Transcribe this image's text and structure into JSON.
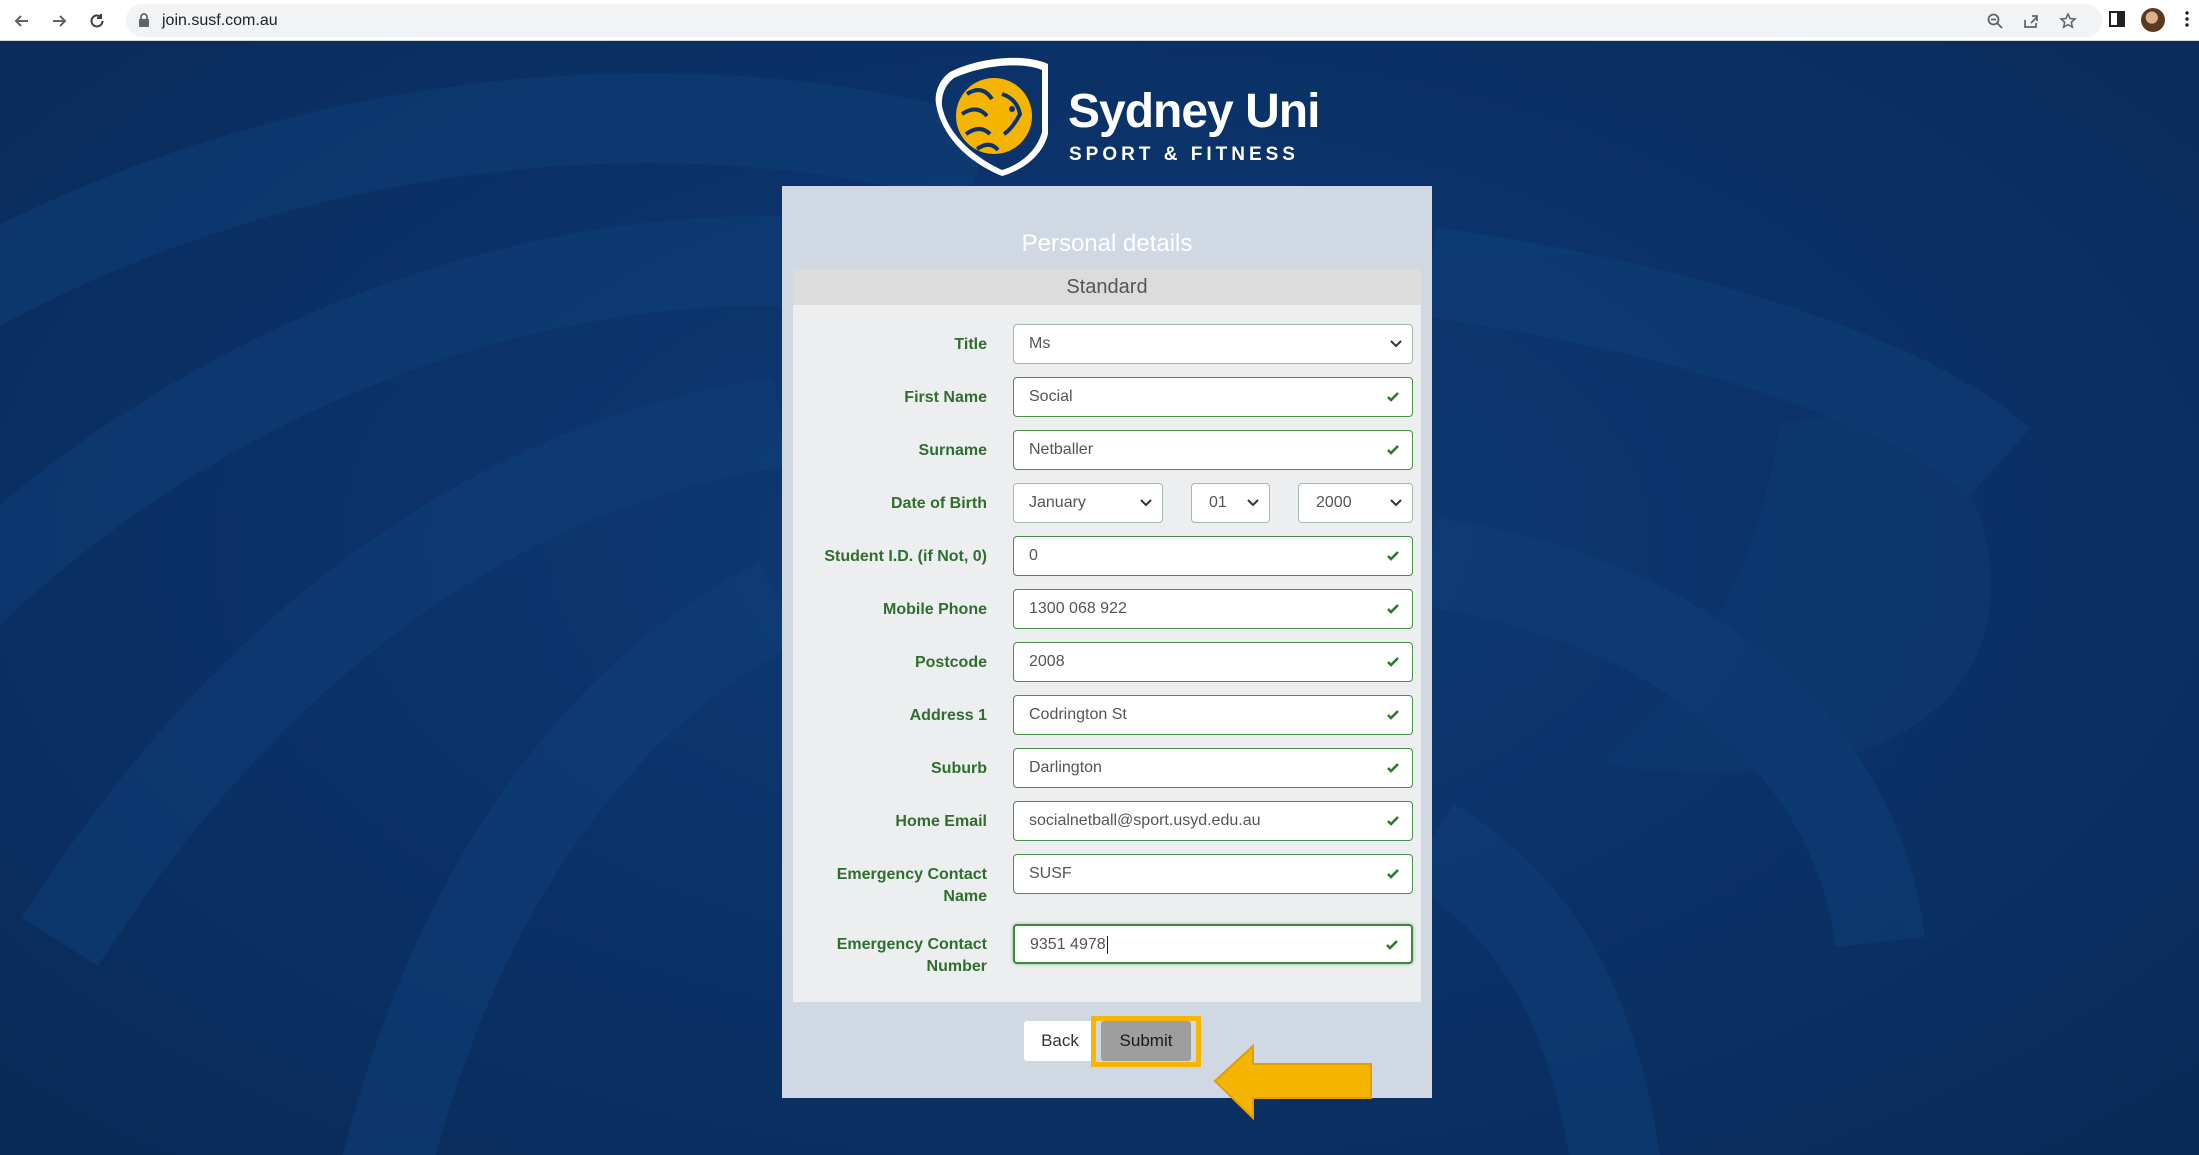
{
  "browser": {
    "url": "join.susf.com.au",
    "icons": [
      "back-arrow-icon",
      "forward-arrow-icon",
      "reload-icon",
      "lock-icon",
      "zoom-icon",
      "share-icon",
      "bookmark-star-icon",
      "side-panel-icon",
      "profile-avatar",
      "menu-kebab-icon"
    ]
  },
  "brand": {
    "name": "Sydney Uni",
    "tagline": "SPORT & FITNESS"
  },
  "form": {
    "title": "Personal details",
    "section": "Standard",
    "fields": [
      {
        "label": "Title",
        "value": "Ms",
        "type": "select"
      },
      {
        "label": "First Name",
        "value": "Social",
        "type": "text"
      },
      {
        "label": "Surname",
        "value": "Netballer",
        "type": "text"
      },
      {
        "label": "Date of Birth",
        "month": "January",
        "day": "01",
        "year": "2000",
        "type": "date-selects"
      },
      {
        "label": "Student I.D. (if Not, 0)",
        "value": "0",
        "type": "text"
      },
      {
        "label": "Mobile Phone",
        "value": "1300 068 922",
        "type": "text"
      },
      {
        "label": "Postcode",
        "value": "2008",
        "type": "text"
      },
      {
        "label": "Address 1",
        "value": "Codrington St",
        "type": "text"
      },
      {
        "label": "Suburb",
        "value": "Darlington",
        "type": "text"
      },
      {
        "label": "Home Email",
        "value": "socialnetball@sport.usyd.edu.au",
        "type": "text"
      },
      {
        "label": "Emergency Contact Name",
        "value": "SUSF",
        "type": "text"
      },
      {
        "label": "Emergency Contact Number",
        "value": "9351 4978",
        "type": "text"
      }
    ],
    "back_label": "Back",
    "submit_label": "Submit"
  },
  "annotation": {
    "highlight_color": "#f7b500"
  }
}
